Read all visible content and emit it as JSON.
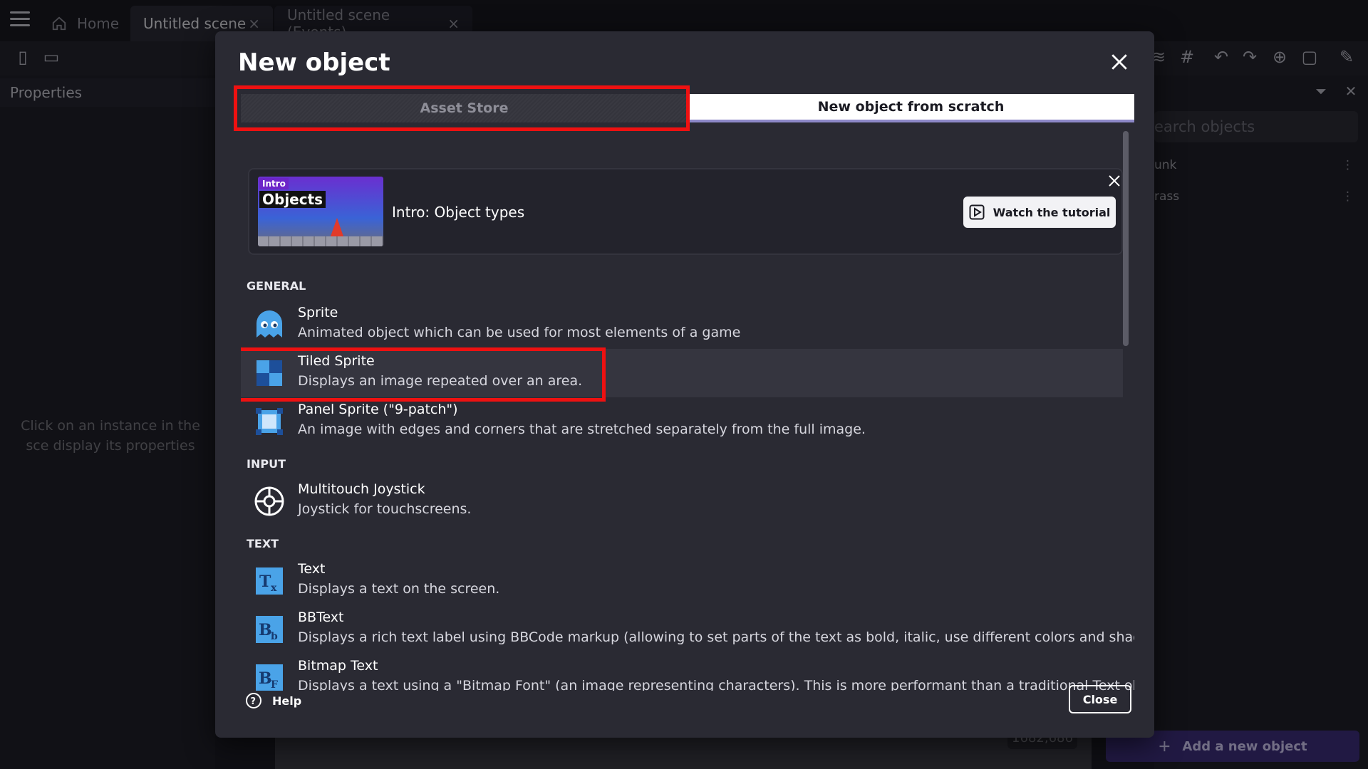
{
  "editor": {
    "tabs": [
      {
        "label": "Home"
      },
      {
        "label": "Untitled scene",
        "close": "×"
      },
      {
        "label": "Untitled scene (Events)",
        "close": "×"
      }
    ],
    "properties_title": "Properties",
    "properties_hint": "Click on an instance in the sce display its properties",
    "objects_search_placeholder": "earch objects",
    "objects": [
      {
        "name": "unk"
      },
      {
        "name": "rass"
      }
    ],
    "coords": "1682,686",
    "add_object_label": "Add a new object"
  },
  "modal": {
    "title": "New object",
    "tabs": {
      "asset_store": "Asset Store",
      "from_scratch": "New object from scratch"
    },
    "tutorial": {
      "thumb_badge": "Intro",
      "thumb_title": "Objects",
      "title": "Intro: Object types",
      "button": "Watch the tutorial"
    },
    "sections": {
      "general": "GENERAL",
      "input": "INPUT",
      "text": "TEXT"
    },
    "items": [
      {
        "name": "Sprite",
        "desc": "Animated object which can be used for most elements of a game"
      },
      {
        "name": "Tiled Sprite",
        "desc": "Displays an image repeated over an area."
      },
      {
        "name": "Panel Sprite (\"9-patch\")",
        "desc": "An image with edges and corners that are stretched separately from the full image."
      },
      {
        "name": "Multitouch Joystick",
        "desc": "Joystick for touchscreens."
      },
      {
        "name": "Text",
        "desc": "Displays a text on the screen."
      },
      {
        "name": "BBText",
        "desc": "Displays a rich text label using BBCode markup (allowing to set parts of the text as bold, italic, use different colors and shadows)."
      },
      {
        "name": "Bitmap Text",
        "desc": "Displays a text using a \"Bitmap Font\" (an image representing characters). This is more performant than a traditional Text object."
      }
    ],
    "help_label": "Help",
    "close_label": "Close"
  },
  "colors": {
    "highlight_box": "#ee1111",
    "accent": "#8d88c8"
  }
}
